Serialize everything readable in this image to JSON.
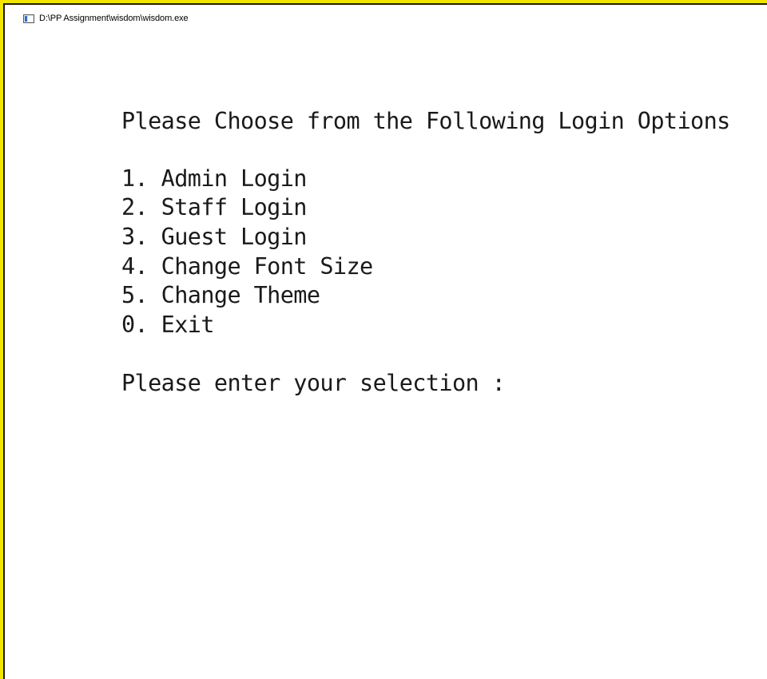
{
  "window": {
    "title": "D:\\PP Assignment\\wisdom\\wisdom.exe",
    "icon": "console-app-icon"
  },
  "console": {
    "heading": "Please Choose from the Following Login Options",
    "options": [
      "1. Admin Login",
      "2. Staff Login",
      "3. Guest Login",
      "4. Change Font Size",
      "5. Change Theme",
      "0. Exit"
    ],
    "prompt": "Please enter your selection :"
  },
  "colors": {
    "frame": "#f2e600",
    "background": "#ffffff",
    "text": "#1a1a1a"
  }
}
